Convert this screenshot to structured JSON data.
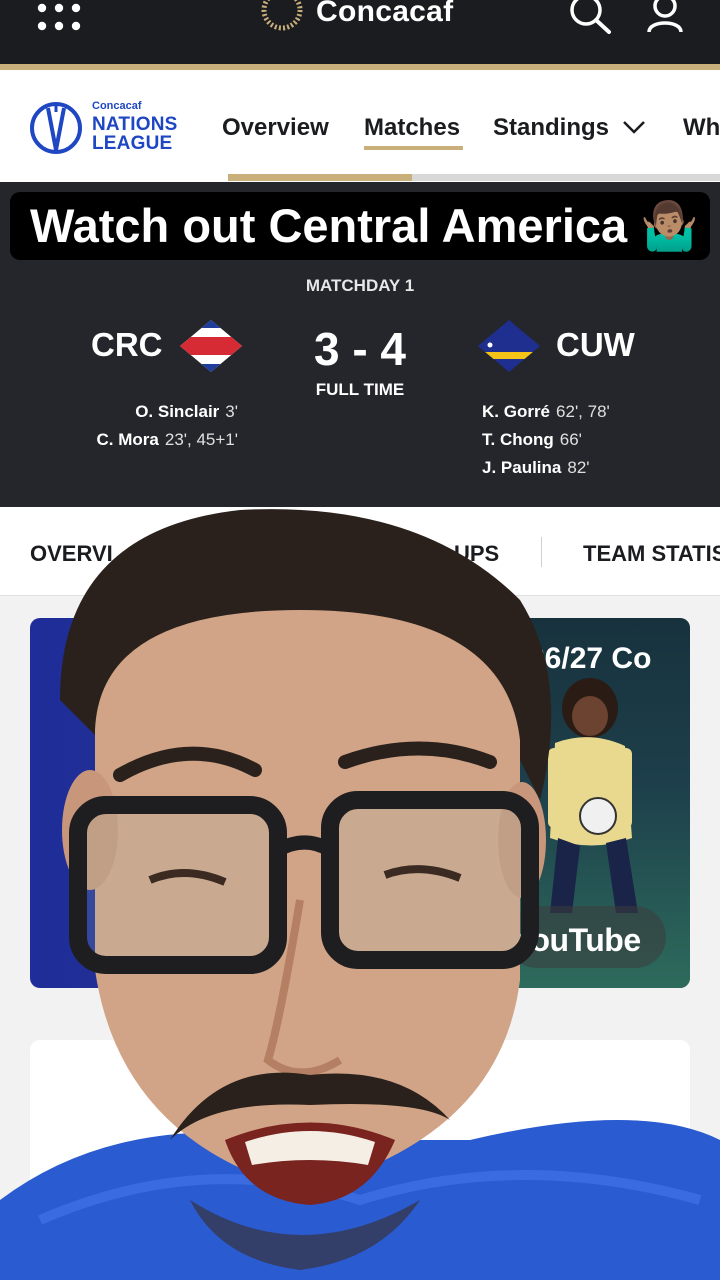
{
  "topbar": {
    "brand": "Concacaf",
    "icons": [
      "grid-menu-icon",
      "concacaf-logo-icon",
      "search-icon",
      "user-icon"
    ]
  },
  "nav": {
    "logo_small": "Concacaf",
    "logo_line1": "NATIONS",
    "logo_line2": "LEAGUE",
    "items": [
      "Overview",
      "Matches",
      "Standings",
      "Wh"
    ],
    "active": "Matches"
  },
  "caption": {
    "text": "Watch out Central America 🤷🏽‍♂️"
  },
  "match": {
    "matchday": "MATCHDAY 1",
    "home": {
      "code": "CRC"
    },
    "away": {
      "code": "CUW"
    },
    "score": "3 - 4",
    "status": "FULL TIME",
    "home_scorers": [
      {
        "name": "O. Sinclair",
        "minutes": "3'"
      },
      {
        "name": "C. Mora",
        "minutes": "23', 45+1'"
      }
    ],
    "away_scorers": [
      {
        "name": "K. Gorré",
        "minutes": "62', 78'"
      },
      {
        "name": "T. Chong",
        "minutes": "66'"
      },
      {
        "name": "J. Paulina",
        "minutes": "82'"
      }
    ]
  },
  "tabs": {
    "items": [
      "OVERVI",
      "UPS",
      "TEAM STATIS"
    ]
  },
  "promo": {
    "title": "26/27 Co",
    "youtube_label": "YouTube"
  },
  "colors": {
    "gold": "#c9b07a",
    "dark": "#25262b",
    "nations_blue": "#1f47c4"
  }
}
